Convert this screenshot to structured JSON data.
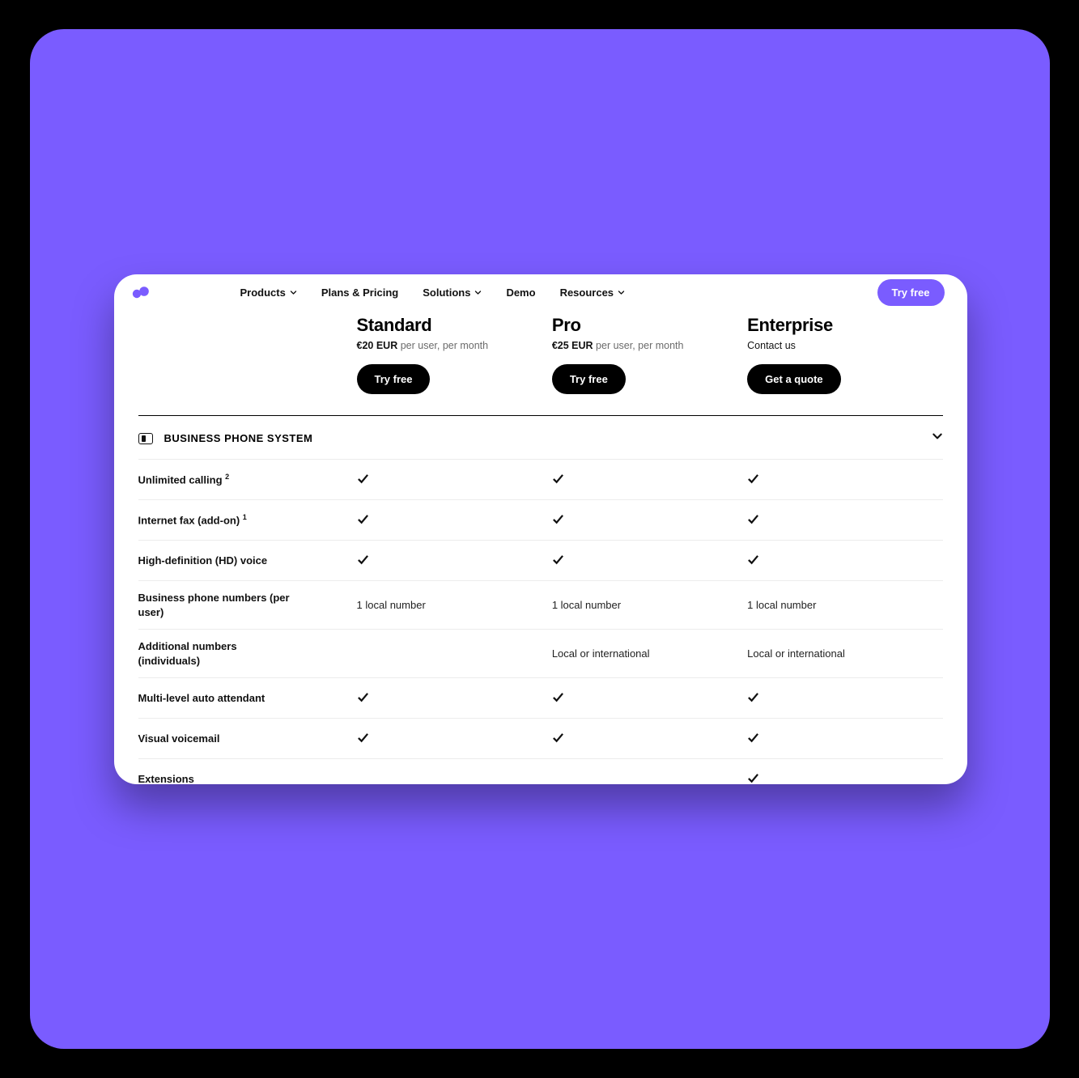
{
  "nav": {
    "items": [
      {
        "label": "Products",
        "dropdown": true
      },
      {
        "label": "Plans & Pricing",
        "dropdown": false
      },
      {
        "label": "Solutions",
        "dropdown": true
      },
      {
        "label": "Demo",
        "dropdown": false
      },
      {
        "label": "Resources",
        "dropdown": true
      }
    ],
    "cta": "Try free"
  },
  "plans": [
    {
      "name": "Standard",
      "price": "€20 EUR",
      "suffix": "per user, per month",
      "cta": "Try free"
    },
    {
      "name": "Pro",
      "price": "€25 EUR",
      "suffix": "per user, per month",
      "cta": "Try free"
    },
    {
      "name": "Enterprise",
      "price": "Contact us",
      "suffix": "",
      "cta": "Get a quote"
    }
  ],
  "section": {
    "title": "BUSINESS PHONE SYSTEM"
  },
  "features": [
    {
      "label": "Unlimited calling",
      "sup": "2",
      "cells": [
        "check",
        "check",
        "check"
      ]
    },
    {
      "label": "Internet fax (add-on)",
      "sup": "1",
      "cells": [
        "check",
        "check",
        "check"
      ]
    },
    {
      "label": "High-definition (HD) voice",
      "sup": "",
      "cells": [
        "check",
        "check",
        "check"
      ]
    },
    {
      "label": "Business phone numbers (per user)",
      "sup": "",
      "cells": [
        "1 local number",
        "1 local number",
        "1 local number"
      ]
    },
    {
      "label": "Additional numbers (individuals)",
      "sup": "",
      "cells": [
        "dash",
        "Local or international",
        "Local or international"
      ]
    },
    {
      "label": "Multi-level auto attendant",
      "sup": "",
      "cells": [
        "check",
        "check",
        "check"
      ]
    },
    {
      "label": "Visual voicemail",
      "sup": "",
      "cells": [
        "check",
        "check",
        "check"
      ]
    },
    {
      "label": "Extensions",
      "sup": "",
      "cells": [
        "dash",
        "dash",
        "check"
      ]
    }
  ]
}
